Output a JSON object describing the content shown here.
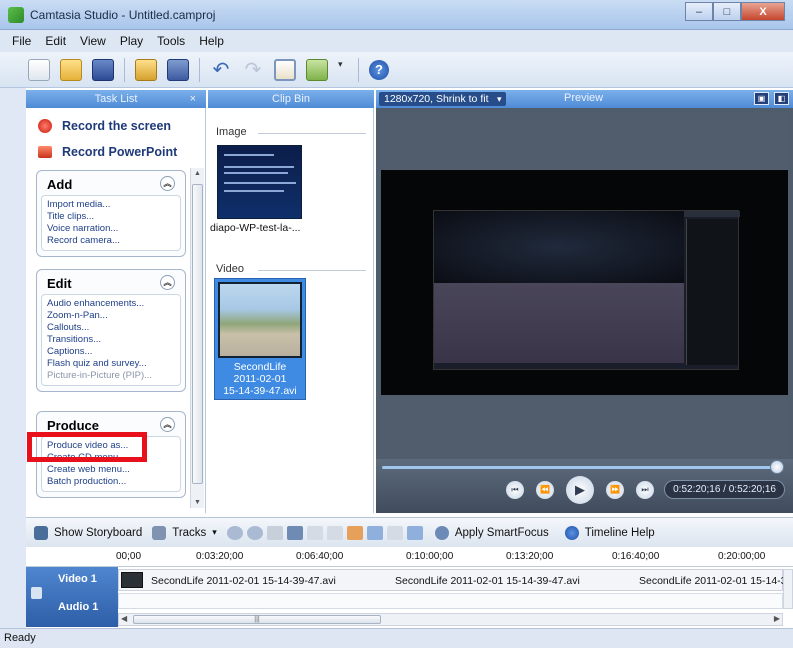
{
  "window": {
    "title": "Camtasia Studio - Untitled.camproj"
  },
  "window_controls": {
    "minimize": "–",
    "maximize": "□",
    "close": "X"
  },
  "menu": [
    "File",
    "Edit",
    "View",
    "Play",
    "Tools",
    "Help"
  ],
  "toolbar": {
    "icons": [
      "new-icon",
      "open-icon",
      "save-icon",
      "import-icon",
      "save-as-icon",
      "undo-icon",
      "redo-icon",
      "task-list-icon",
      "library-icon",
      "help-icon"
    ]
  },
  "tasklist": {
    "header": "Task List",
    "close": "×",
    "record_screen": "Record the screen",
    "record_ppt": "Record PowerPoint",
    "groups": {
      "add": {
        "title": "Add",
        "items": [
          "Import media...",
          "Title clips...",
          "Voice narration...",
          "Record camera..."
        ]
      },
      "edit": {
        "title": "Edit",
        "items": [
          "Audio enhancements...",
          "Zoom-n-Pan...",
          "Callouts...",
          "Transitions...",
          "Captions...",
          "Flash quiz and survey...",
          "Picture-in-Picture (PIP)..."
        ]
      },
      "produce": {
        "title": "Produce",
        "items": [
          "Produce video as...",
          "Create CD menu...",
          "Create web menu...",
          "Batch production..."
        ]
      }
    }
  },
  "clipbin": {
    "header": "Clip Bin",
    "image_section": "Image",
    "image_caption": "diapo-WP-test-la-...",
    "video_section": "Video",
    "video_caption_1": "SecondLife",
    "video_caption_2": "2011-02-01",
    "video_caption_3": "15-14-39-47.avi"
  },
  "preview": {
    "size_option": "1280x720, Shrink to fit",
    "title": "Preview",
    "timecode": "0:52:20;16 / 0:52:20;16",
    "progress_fraction": 1.0
  },
  "timeline_toolbar": {
    "show_storyboard": "Show Storyboard",
    "tracks": "Tracks",
    "apply_smartfocus": "Apply SmartFocus",
    "timeline_help": "Timeline Help"
  },
  "ruler": [
    "00;00",
    "0:03:20;00",
    "0:06:40;00",
    "0:10:00;00",
    "0:13:20;00",
    "0:16:40;00",
    "0:20:00;00"
  ],
  "tracks": {
    "video_label": "Video 1",
    "audio_label": "Audio 1",
    "clips": [
      "SecondLife 2011-02-01 15-14-39-47.avi",
      "SecondLife 2011-02-01 15-14-39-47.avi",
      "SecondLife 2011-02-01 15-14-3"
    ]
  },
  "status": "Ready",
  "colors": {
    "accent": "#4f8ad6",
    "highlight": "#e8101b",
    "selection": "#3f8be3"
  }
}
